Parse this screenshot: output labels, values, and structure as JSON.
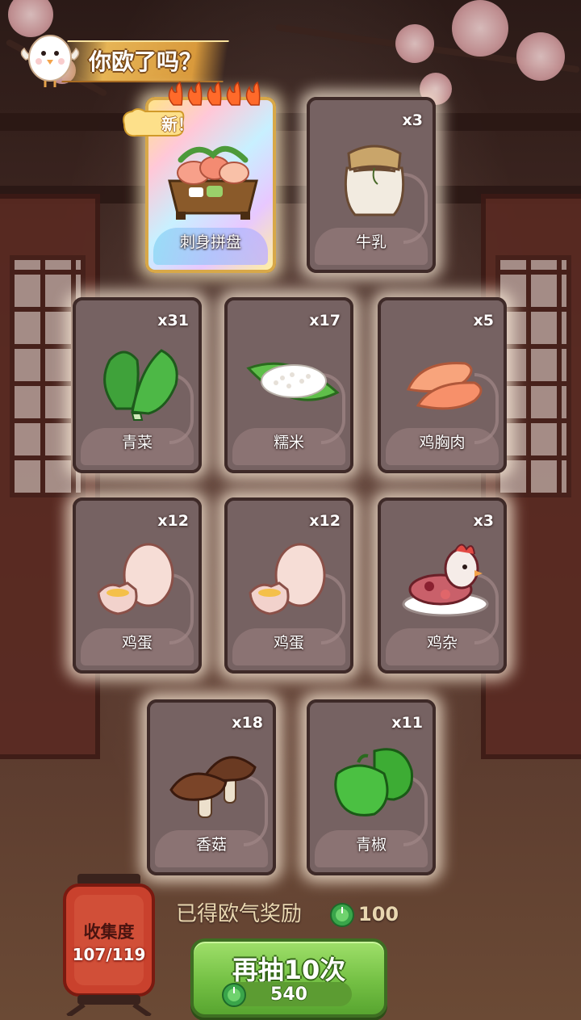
{
  "header": {
    "title": "你欧了吗？"
  },
  "special_card": {
    "badge": "新！",
    "name": "刺身拼盘",
    "stars": 5,
    "icon": "sashimi-platter-icon"
  },
  "cards": [
    {
      "name": "牛乳",
      "count": "x3",
      "icon": "milk-jar-icon"
    },
    {
      "name": "青菜",
      "count": "x31",
      "icon": "bok-choy-icon"
    },
    {
      "name": "糯米",
      "count": "x17",
      "icon": "glutinous-rice-icon"
    },
    {
      "name": "鸡胸肉",
      "count": "x5",
      "icon": "chicken-breast-icon"
    },
    {
      "name": "鸡蛋",
      "count": "x12",
      "icon": "egg-icon"
    },
    {
      "name": "鸡蛋",
      "count": "x12",
      "icon": "egg-icon"
    },
    {
      "name": "鸡杂",
      "count": "x3",
      "icon": "chicken-offal-icon"
    },
    {
      "name": "香菇",
      "count": "x18",
      "icon": "shiitake-icon"
    },
    {
      "name": "青椒",
      "count": "x11",
      "icon": "green-pepper-icon"
    }
  ],
  "collection": {
    "label": "收集度",
    "value": "107/119"
  },
  "reward": {
    "label": "已得欧气奖励",
    "amount": "100",
    "icon": "green-coin-icon"
  },
  "draw_button": {
    "label": "再抽10次",
    "cost": "540",
    "icon": "green-coin-icon"
  },
  "colors": {
    "card_bg": "#766262",
    "card_border": "#3e2a28",
    "button_green": "#74c044",
    "banner_gold": "#e6b455",
    "lantern_red": "#c9412d"
  }
}
